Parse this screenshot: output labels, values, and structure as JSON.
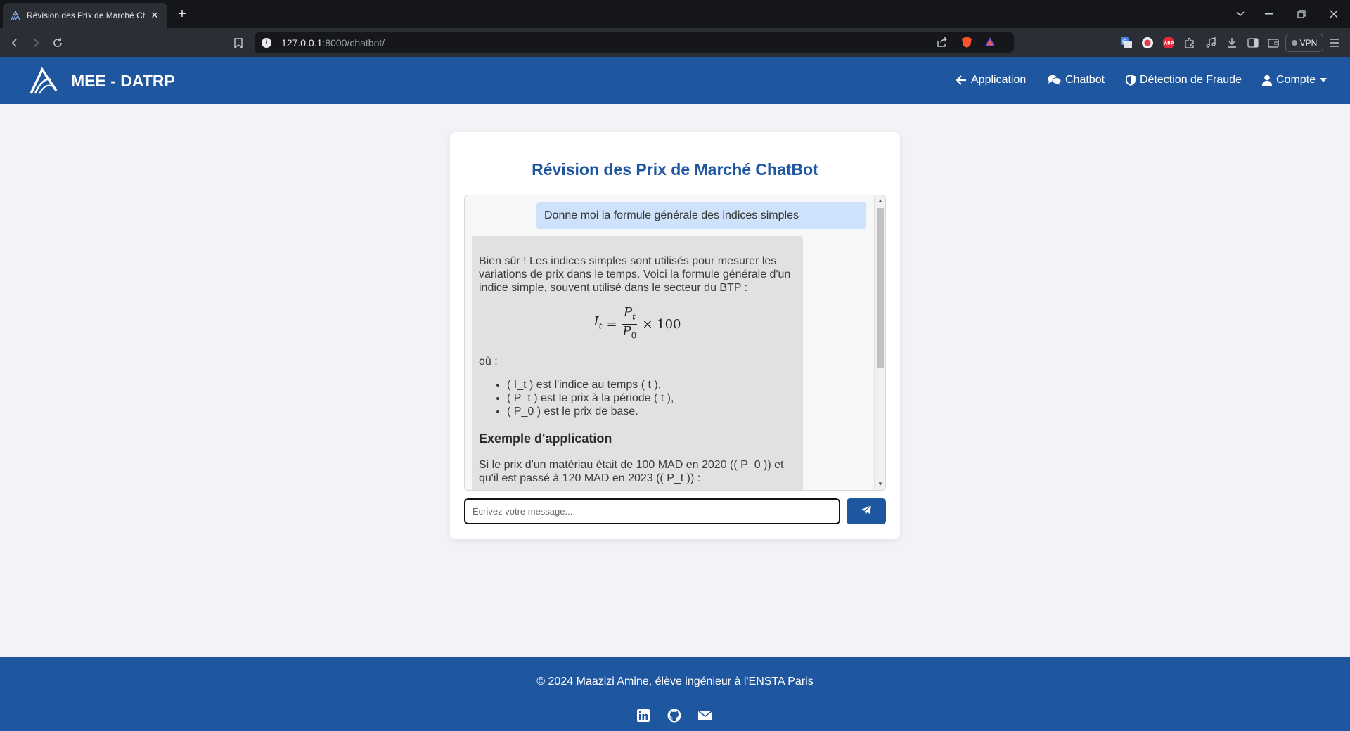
{
  "browser": {
    "tab_title": "Révision des Prix de Marché Ch",
    "url_host": "127.0.0.1",
    "url_path": ":8000/chatbot/",
    "vpn_label": "VPN"
  },
  "header": {
    "brand": "MEE - DATRP",
    "nav": {
      "application": "Application",
      "chatbot": "Chatbot",
      "fraud": "Détection de Fraude",
      "account": "Compte"
    }
  },
  "chat": {
    "title": "Révision des Prix de Marché ChatBot",
    "user_message": "Donne moi la formule générale des indices simples",
    "bot": {
      "intro": "Bien sûr ! Les indices simples sont utilisés pour mesurer les variations de prix dans le temps. Voici la formule générale d'un indice simple, souvent utilisé dans le secteur du BTP :",
      "formula": {
        "lhs": "I",
        "lhs_sub": "t",
        "num": "P",
        "num_sub": "t",
        "den": "P",
        "den_sub": "0",
        "rhs": "× 100"
      },
      "where": "où :",
      "bullets": [
        "( I_t ) est l'indice au temps ( t ),",
        "( P_t ) est le prix à la période ( t ),",
        "( P_0 ) est le prix de base."
      ],
      "example_heading": "Exemple d'application",
      "example_text": "Si le prix d'un matériau était de 100 MAD en 2020 (( P_0 )) et qu'il est passé à 120 MAD en 2023 (( P_t )) :"
    },
    "input_placeholder": "Écrivez votre message..."
  },
  "footer": {
    "text": "© 2024 Maazizi Amine, élève ingénieur à l'ENSTA Paris"
  },
  "icons": {
    "linkedin": "linkedin-icon",
    "github": "github-icon",
    "email": "envelope-icon",
    "send": "paper-plane-icon"
  },
  "colors": {
    "primary": "#1f56a0",
    "user_bubble": "#cfe2fb",
    "bot_bubble": "#e1e1e1"
  }
}
